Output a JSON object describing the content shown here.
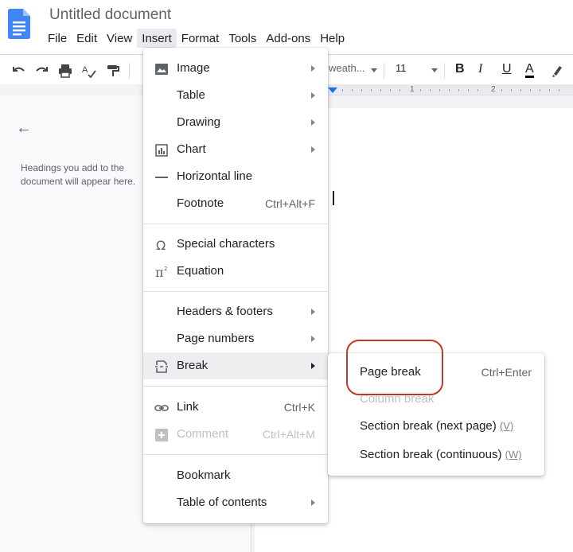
{
  "header": {
    "title": "Untitled document",
    "menu": [
      "File",
      "Edit",
      "View",
      "Insert",
      "Format",
      "Tools",
      "Add-ons",
      "Help"
    ]
  },
  "toolbar": {
    "font_label": "weath...",
    "font_size": "11",
    "bold": "B",
    "italic": "I",
    "underline": "U",
    "text_color": "A"
  },
  "ruler": {
    "num1": "1",
    "num2": "2"
  },
  "outline": {
    "hint": "Headings you add to the document will appear here."
  },
  "insert_menu": {
    "items": [
      {
        "label": "Image",
        "shortcut": ""
      },
      {
        "label": "Table",
        "shortcut": ""
      },
      {
        "label": "Drawing",
        "shortcut": ""
      },
      {
        "label": "Chart",
        "shortcut": ""
      },
      {
        "label": "Horizontal line",
        "shortcut": ""
      },
      {
        "label": "Footnote",
        "shortcut": "Ctrl+Alt+F"
      },
      {
        "label": "Special characters",
        "shortcut": ""
      },
      {
        "label": "Equation",
        "shortcut": ""
      },
      {
        "label": "Headers & footers",
        "shortcut": ""
      },
      {
        "label": "Page numbers",
        "shortcut": ""
      },
      {
        "label": "Break",
        "shortcut": ""
      },
      {
        "label": "Link",
        "shortcut": "Ctrl+K"
      },
      {
        "label": "Comment",
        "shortcut": "Ctrl+Alt+M"
      },
      {
        "label": "Bookmark",
        "shortcut": ""
      },
      {
        "label": "Table of contents",
        "shortcut": ""
      }
    ]
  },
  "break_submenu": {
    "items": [
      {
        "label": "Page break",
        "shortcut": "Ctrl+Enter",
        "hint": ""
      },
      {
        "label": "Column break",
        "shortcut": "",
        "hint": ""
      },
      {
        "label": "Section break (next page)",
        "shortcut": "",
        "hint": "(V)"
      },
      {
        "label": "Section break (continuous)",
        "shortcut": "",
        "hint": "(W)"
      }
    ]
  },
  "colors": {
    "accent": "#1a73e8",
    "highlight_annotation": "#c0392b",
    "doc_icon": "#4285f4"
  }
}
